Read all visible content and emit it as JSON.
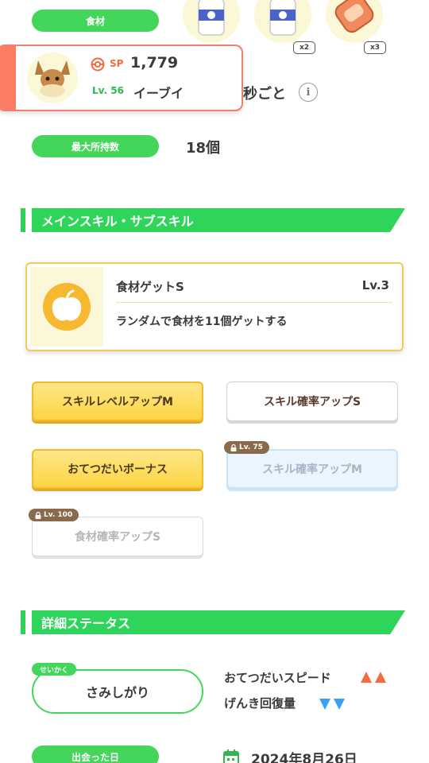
{
  "ingredients": {
    "label": "食材",
    "items": [
      {
        "name": "milk-bottle-icon",
        "count": ""
      },
      {
        "name": "milk-bottle-icon",
        "count": "x2"
      },
      {
        "name": "bacon-icon",
        "count": "x3"
      }
    ]
  },
  "pokemon": {
    "sp_label": "SP",
    "sp_value": "1,779",
    "level": "Lv. 56",
    "name": "イーブイ"
  },
  "help_time": {
    "suffix": "秒ごと",
    "info_icon": "info-icon"
  },
  "max_capacity": {
    "label": "最大所持数",
    "value": "18個"
  },
  "skills_section": {
    "title": "メインスキル・サブスキル",
    "main_skill": {
      "name": "食材ゲットS",
      "level": "Lv.3",
      "description": "ランダムで食材を11個ゲットする",
      "icon": "apple-icon"
    },
    "sub_skills": [
      {
        "label": "スキルレベルアップM",
        "lock": ""
      },
      {
        "label": "スキル確率アップS",
        "lock": ""
      },
      {
        "label": "おてつだいボーナス",
        "lock": ""
      },
      {
        "label": "スキル確率アップM",
        "lock": "Lv. 75"
      },
      {
        "label": "食材確率アップS",
        "lock": "Lv. 100"
      }
    ]
  },
  "details_section": {
    "title": "詳細ステータス",
    "nature_tag": "せいかく",
    "nature": "さみしがり",
    "up_stat": "おてつだいスピード",
    "down_stat": "げんき回復量",
    "met_label": "出会った日",
    "met_date": "2024年8月26日"
  },
  "colors": {
    "green": "#43d65b",
    "gold": "#fcd443",
    "up_arrow": "#f36b3f",
    "down_arrow": "#3aa0f2"
  }
}
